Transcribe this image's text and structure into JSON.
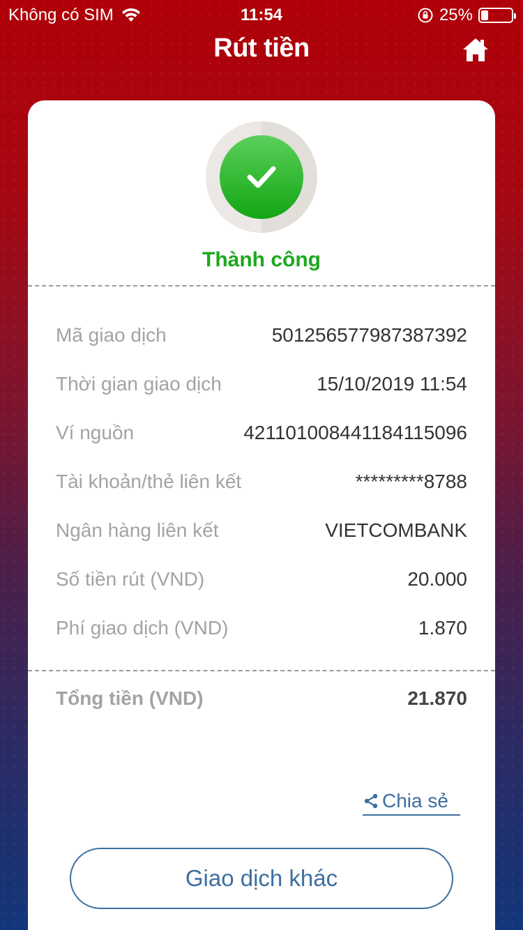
{
  "status_bar": {
    "carrier": "Không có SIM",
    "time": "11:54",
    "battery": "25%"
  },
  "header": {
    "title": "Rút tiền",
    "home_icon": "home-icon"
  },
  "result": {
    "status": "Thành công",
    "icon": "check-icon",
    "accent_color": "#1ea81e"
  },
  "details": [
    {
      "label": "Mã giao dịch",
      "value": "501256577987387392"
    },
    {
      "label": "Thời gian giao dịch",
      "value": "15/10/2019 11:54"
    },
    {
      "label": "Ví nguồn",
      "value": "421101008441184115096"
    },
    {
      "label": "Tài khoản/thẻ liên kết",
      "value": "*********8788"
    },
    {
      "label": "Ngân hàng liên kết",
      "value": "VIETCOMBANK"
    },
    {
      "label": "Số tiền rút (VND)",
      "value": "20.000"
    },
    {
      "label": "Phí giao dịch (VND)",
      "value": "1.870"
    }
  ],
  "total": {
    "label": "Tổng tiền (VND)",
    "value": "21.870"
  },
  "actions": {
    "share_label": "Chia sẻ",
    "share_icon": "share-icon",
    "other_transaction_label": "Giao dịch khác",
    "link_color": "#3c6fa0"
  }
}
